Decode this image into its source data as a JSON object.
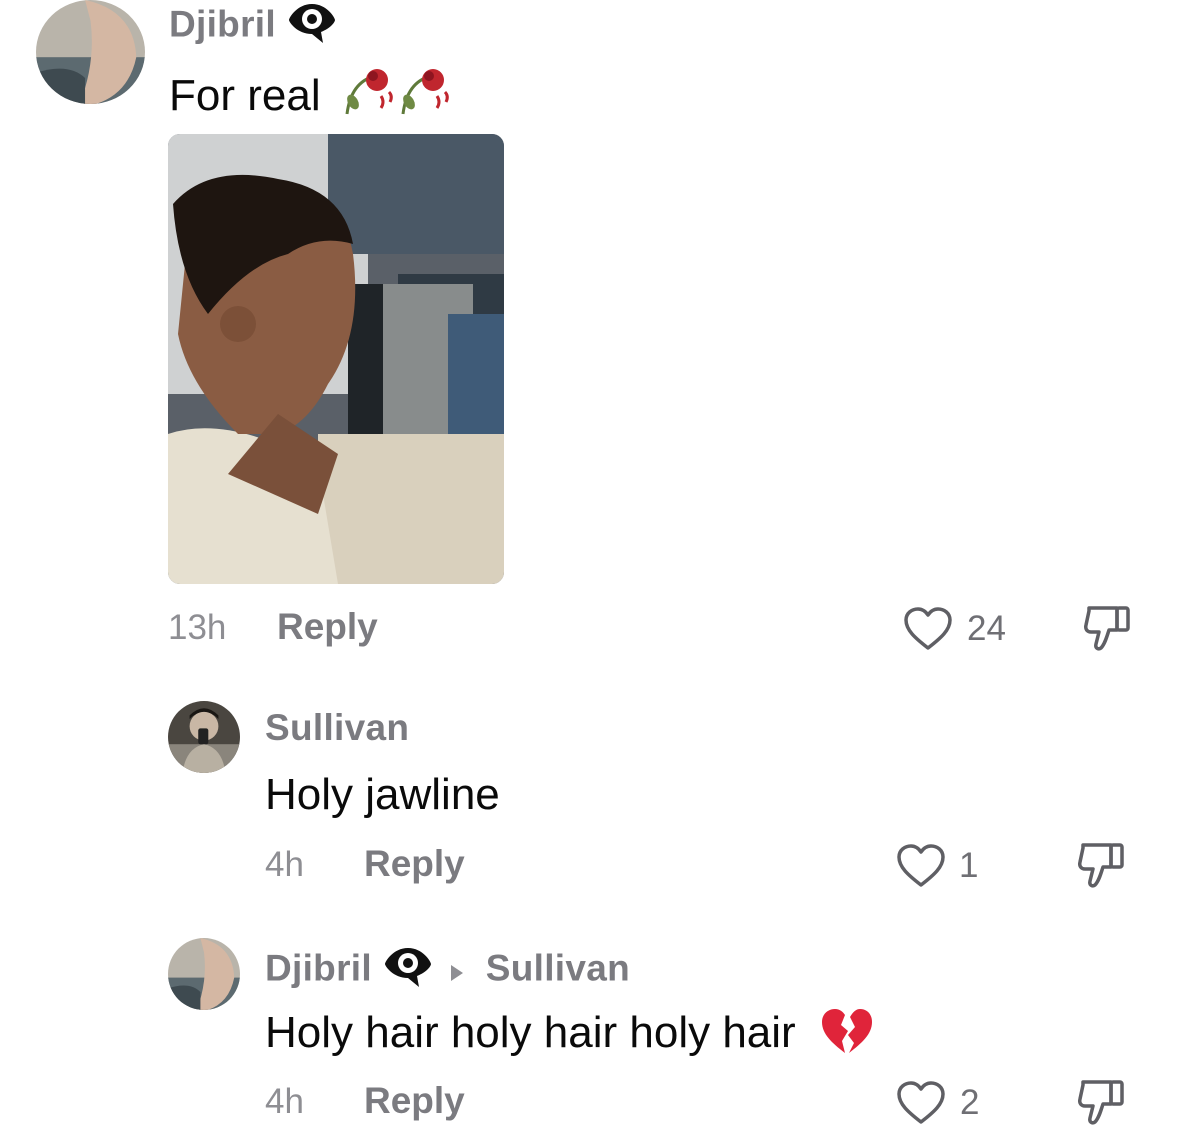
{
  "comments": [
    {
      "username": "Djibril",
      "text": "For real",
      "time": "13h",
      "reply_label": "Reply",
      "likes": "24",
      "icons": {
        "badge": "eye-badge-icon",
        "emoji": "wilted-rose-emoji-icon",
        "like": "heart-outline-icon",
        "dislike": "thumbs-down-icon"
      }
    },
    {
      "username": "Sullivan",
      "text": "Holy jawline",
      "time": "4h",
      "reply_label": "Reply",
      "likes": "1",
      "icons": {
        "like": "heart-outline-icon",
        "dislike": "thumbs-down-icon"
      }
    },
    {
      "username": "Djibril",
      "reply_to": "Sullivan",
      "text": "Holy hair holy hair holy hair",
      "time": "4h",
      "reply_label": "Reply",
      "likes": "2",
      "icons": {
        "badge": "eye-badge-icon",
        "arrow": "caret-right-icon",
        "emoji": "broken-heart-emoji-icon",
        "like": "heart-outline-icon",
        "dislike": "thumbs-down-icon"
      }
    }
  ],
  "colors": {
    "username": "#7b7b80",
    "meta": "#8e8e93",
    "text": "#0a0a0a",
    "broken_heart": "#e0243a"
  }
}
